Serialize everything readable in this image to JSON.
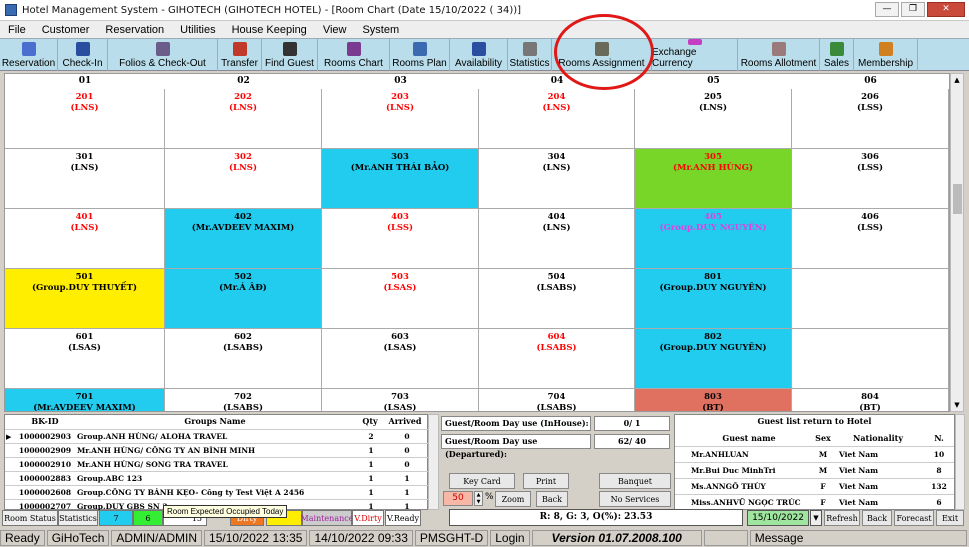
{
  "window": {
    "title": "Hotel Management System - GIHOTECH (GIHOTECH HOTEL) - [Room Chart (Date 15/10/2022 ( 34))]"
  },
  "menu": [
    "File",
    "Customer",
    "Reservation",
    "Utilities",
    "House Keeping",
    "View",
    "System"
  ],
  "toolbar": [
    {
      "label": "Reservation",
      "icon": "pen-icon",
      "color": "#4a6fcf"
    },
    {
      "label": "Check-In",
      "icon": "people-icon",
      "color": "#2a4e9f"
    },
    {
      "label": "Folios & Check-Out",
      "icon": "folio-icon",
      "color": "#6b5d8a"
    },
    {
      "label": "Transfer",
      "icon": "house-icon",
      "color": "#c0392b"
    },
    {
      "label": "Find Guest",
      "icon": "binoculars-icon",
      "color": "#333"
    },
    {
      "label": "Rooms Chart",
      "icon": "chart-icon",
      "color": "#7a3a90"
    },
    {
      "label": "Rooms Plan",
      "icon": "plan-icon",
      "color": "#3b6ab0"
    },
    {
      "label": "Availability",
      "icon": "bars-icon",
      "color": "#2c4ea0"
    },
    {
      "label": "Statistics",
      "icon": "stats-icon",
      "color": "#777"
    },
    {
      "label": "Rooms Assignment",
      "icon": "door-icon",
      "color": "#6a6a5a"
    },
    {
      "label": "Exchange Currency",
      "icon": "dollar-icon",
      "color": "#c43cc4"
    },
    {
      "label": "Rooms Allotment",
      "icon": "lock-icon",
      "color": "#9a7a7a"
    },
    {
      "label": "Sales",
      "icon": "money-icon",
      "color": "#3a8a3a"
    },
    {
      "label": "Membership",
      "icon": "card-icon",
      "color": "#d08020"
    }
  ],
  "chart": {
    "columns": [
      "01",
      "02",
      "03",
      "04",
      "05",
      "06"
    ],
    "rows": [
      [
        {
          "n": "201",
          "s": "(LNS)",
          "c": "red",
          "bg": "#ffffff"
        },
        {
          "n": "202",
          "s": "(LNS)",
          "c": "red",
          "bg": "#ffffff"
        },
        {
          "n": "203",
          "s": "(LNS)",
          "c": "red",
          "bg": "#ffffff"
        },
        {
          "n": "204",
          "s": "(LNS)",
          "c": "red",
          "bg": "#ffffff"
        },
        {
          "n": "205",
          "s": "(LNS)",
          "c": "black",
          "bg": "#ffffff"
        },
        {
          "n": "206",
          "s": "(LSS)",
          "c": "black",
          "bg": "#ffffff"
        }
      ],
      [
        {
          "n": "301",
          "s": "(LNS)",
          "c": "black",
          "bg": "#ffffff"
        },
        {
          "n": "302",
          "s": "(LNS)",
          "c": "red",
          "bg": "#ffffff"
        },
        {
          "n": "303",
          "s": "(Mr.ANH THÁI BẢO)",
          "c": "black",
          "bg": "#22ccee"
        },
        {
          "n": "304",
          "s": "(LNS)",
          "c": "black",
          "bg": "#ffffff"
        },
        {
          "n": "305",
          "s": "(Mr.ANH HÙNG)",
          "c": "red",
          "bg": "#77d627"
        },
        {
          "n": "306",
          "s": "(LSS)",
          "c": "black",
          "bg": "#ffffff"
        }
      ],
      [
        {
          "n": "401",
          "s": "(LNS)",
          "c": "red",
          "bg": "#ffffff"
        },
        {
          "n": "402",
          "s": "(Mr.AVDEEV MAXIM)",
          "c": "black",
          "bg": "#22ccee"
        },
        {
          "n": "403",
          "s": "(LSS)",
          "c": "red",
          "bg": "#ffffff"
        },
        {
          "n": "404",
          "s": "(LNS)",
          "c": "black",
          "bg": "#ffffff"
        },
        {
          "n": "405",
          "s": "(Group.DUY NGUYÊN)",
          "c": "#e040e0",
          "bg": "#22ccee"
        },
        {
          "n": "406",
          "s": "(LSS)",
          "c": "black",
          "bg": "#ffffff"
        }
      ],
      [
        {
          "n": "501",
          "s": "(Group.DUY THUYẾT)",
          "c": "black",
          "bg": "#ffee00"
        },
        {
          "n": "502",
          "s": "(Mr.Á ÂĐ)",
          "c": "black",
          "bg": "#22ccee"
        },
        {
          "n": "503",
          "s": "(LSAS)",
          "c": "red",
          "bg": "#ffffff"
        },
        {
          "n": "504",
          "s": "(LSABS)",
          "c": "black",
          "bg": "#ffffff"
        },
        {
          "n": "801",
          "s": "(Group.DUY NGUYÊN)",
          "c": "black",
          "bg": "#22ccee"
        },
        {
          "n": "",
          "s": "",
          "c": "black",
          "bg": "#ffffff"
        }
      ],
      [
        {
          "n": "601",
          "s": "(LSAS)",
          "c": "black",
          "bg": "#ffffff"
        },
        {
          "n": "602",
          "s": "(LSABS)",
          "c": "black",
          "bg": "#ffffff"
        },
        {
          "n": "603",
          "s": "(LSAS)",
          "c": "black",
          "bg": "#ffffff"
        },
        {
          "n": "604",
          "s": "(LSABS)",
          "c": "red",
          "bg": "#ffffff"
        },
        {
          "n": "802",
          "s": "(Group.DUY NGUYÊN)",
          "c": "black",
          "bg": "#22ccee"
        },
        {
          "n": "",
          "s": "",
          "c": "black",
          "bg": "#ffffff"
        }
      ],
      [
        {
          "n": "701",
          "s": "(Mr.AVDEEV MAXIM)",
          "c": "black",
          "bg": "#22ccee"
        },
        {
          "n": "702",
          "s": "(LSABS)",
          "c": "black",
          "bg": "#ffffff"
        },
        {
          "n": "703",
          "s": "(LSAS)",
          "c": "black",
          "bg": "#ffffff"
        },
        {
          "n": "704",
          "s": "(LSABS)",
          "c": "black",
          "bg": "#ffffff"
        },
        {
          "n": "803",
          "s": "(BT)",
          "c": "black",
          "bg": "#e07060"
        },
        {
          "n": "804",
          "s": "(BT)",
          "c": "black",
          "bg": "#ffffff"
        }
      ]
    ]
  },
  "groups": {
    "headers": [
      "BK-ID",
      "Groups Name",
      "Qty",
      "Arrived"
    ],
    "rows": [
      {
        "id": "1000002903",
        "name": "Group.ANH HÙNG/ ALOHA TRAVEL",
        "qty": "2",
        "arr": "0"
      },
      {
        "id": "1000002909",
        "name": "Mr.ANH HÙNG/ CÔNG TY AN BÌNH MINH",
        "qty": "1",
        "arr": "0"
      },
      {
        "id": "1000002910",
        "name": "Mr.ANH HÙNG/ SONG TRA TRAVEL",
        "qty": "1",
        "arr": "0"
      },
      {
        "id": "1000002883",
        "name": "Group.ABC 123",
        "qty": "1",
        "arr": "1",
        "strike": true
      },
      {
        "id": "1000002608",
        "name": "Group.CÔNG TY BÁNH KẸO- Công ty Test Việt A 2456",
        "qty": "1",
        "arr": "1",
        "strike": true
      },
      {
        "id": "1000002707",
        "name": "Group.DUY GBS SN 2...",
        "qty": "1",
        "arr": "1",
        "strike": true
      }
    ]
  },
  "daystats": {
    "inhouse_label": "Guest/Room Day use (InHouse):",
    "inhouse_val": "0/ 1",
    "departed_label": "Guest/Room Day use (Departured):",
    "departed_val": "62/ 40"
  },
  "midbuttons": {
    "keycard": "Key Card",
    "print": "Print",
    "banquet": "Banquet",
    "noservices": "No Services",
    "zoom": "Zoom",
    "back": "Back",
    "zoomval": "50",
    "pct": "%"
  },
  "guests": {
    "title": "Guest list return to Hotel",
    "headers": [
      "Guest name",
      "Sex",
      "Nationality",
      "N."
    ],
    "rows": [
      {
        "name": "Mr.ANHLUAN",
        "sex": "M",
        "nat": "Viet Nam",
        "n": "10"
      },
      {
        "name": "Mr.Bui Duc MinhTri",
        "sex": "M",
        "nat": "Viet Nam",
        "n": "8"
      },
      {
        "name": "Ms.ANNGÔ THÙY",
        "sex": "F",
        "nat": "Viet Nam",
        "n": "132"
      },
      {
        "name": "Miss.ANHVŨ NGỌC TRÚC",
        "sex": "F",
        "nat": "Viet Nam",
        "n": "6"
      }
    ]
  },
  "legend": {
    "room_status": "Room Status",
    "statistics": "Statistics",
    "c1": "7",
    "c2": "6",
    "c4": "15",
    "dirty": "Dirty",
    "maint": "Maintenance",
    "vdirty": "V.Dirty",
    "vready": "V.Ready"
  },
  "tooltip": "Room Expected Occupied Today",
  "summary": "R: 8, G: 3, O(%): 23.53",
  "date": "15/10/2022",
  "navbuttons": {
    "refresh": "Refresh",
    "back": "Back",
    "forecast": "Forecast",
    "exit": "Exit"
  },
  "status": [
    "Ready",
    "GiHoTech",
    "ADMIN/ADMIN",
    "15/10/2022 13:35",
    "14/10/2022 09:33",
    "PMSGHT-D",
    "Login",
    "Version 01.07.2008.100",
    "",
    "Message"
  ]
}
